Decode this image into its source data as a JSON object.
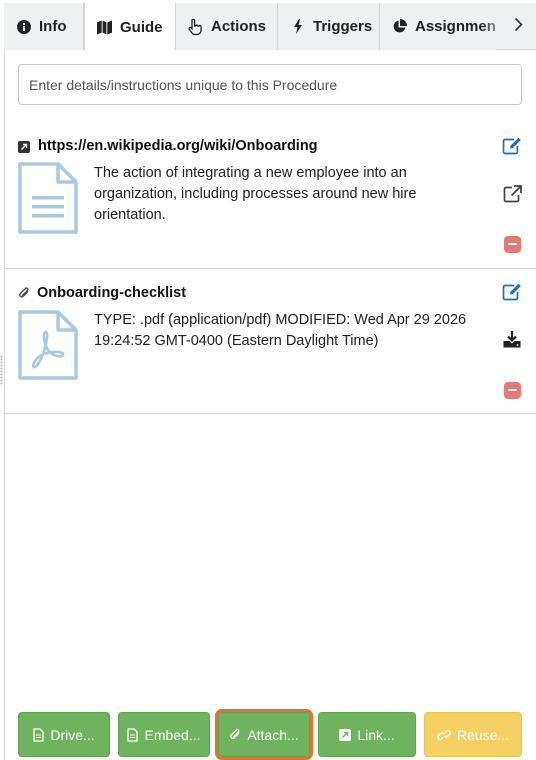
{
  "tabs": [
    {
      "label": "Info",
      "icon": "info-circle-icon"
    },
    {
      "label": "Guide",
      "icon": "map-icon",
      "active": true
    },
    {
      "label": "Actions",
      "icon": "pointer-hand-icon"
    },
    {
      "label": "Triggers",
      "icon": "bolt-icon"
    },
    {
      "label": "Assignment",
      "icon": "pie-chart-icon"
    }
  ],
  "instructions": {
    "placeholder": "Enter details/instructions unique to this Procedure",
    "value": ""
  },
  "items": [
    {
      "type": "link",
      "title": "https://en.wikipedia.org/wiki/Onboarding",
      "description_lines": [
        "The action of integrating a new employee into an",
        "organization, including processes around new hire",
        "orientation."
      ],
      "actions": [
        "edit-icon",
        "external-link-icon",
        "remove-icon"
      ]
    },
    {
      "type": "attachment",
      "title": "Onboarding-checklist",
      "description_lines": [
        "TYPE: .pdf (application/pdf) MODIFIED: Wed Apr 29 2026",
        "19:24:52 GMT-0400 (Eastern Daylight Time)"
      ],
      "actions": [
        "edit-icon",
        "download-icon",
        "remove-icon"
      ]
    }
  ],
  "buttons": [
    {
      "label": "Drive...",
      "icon": "document-icon",
      "color": "#6fb35f"
    },
    {
      "label": "Embed...",
      "icon": "document-icon",
      "color": "#6fb35f"
    },
    {
      "label": "Attach...",
      "icon": "paperclip-icon",
      "color": "#6fb35f",
      "focused": true
    },
    {
      "label": "Link...",
      "icon": "link-square-icon",
      "color": "#6fb35f"
    },
    {
      "label": "Reuse...",
      "icon": "chain-link-icon",
      "color": "#f4cf62"
    }
  ],
  "colors": {
    "accent_blue": "#1f6fbf",
    "remove_red": "#e37b74",
    "focus_orange": "#e8702a",
    "file_icon_blue": "#a9c8e2"
  }
}
